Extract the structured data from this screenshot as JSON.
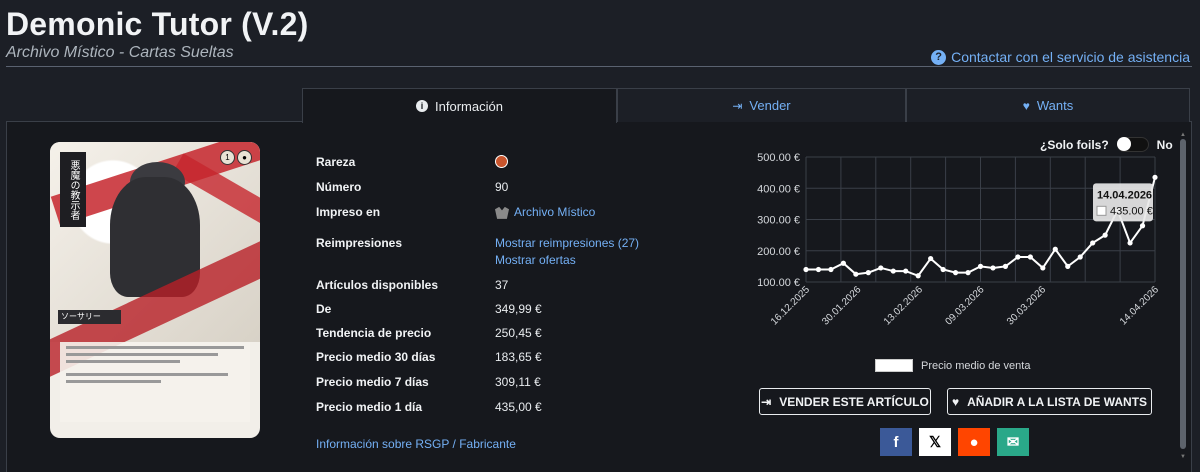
{
  "header": {
    "title": "Demonic Tutor (V.2)",
    "subtitle": "Archivo Místico - Cartas Sueltas",
    "support_link": "Contactar con el servicio de asistencia"
  },
  "tabs": [
    {
      "label": "Información",
      "icon": "info-icon",
      "active": true
    },
    {
      "label": "Vender",
      "icon": "sell-icon",
      "active": false
    },
    {
      "label": "Wants",
      "icon": "heart-icon",
      "active": false
    }
  ],
  "details": {
    "rareza_label": "Rareza",
    "rareza_color": "#c9552d",
    "numero_label": "Número",
    "numero_value": "90",
    "impreso_label": "Impreso en",
    "impreso_value": "Archivo Místico",
    "reimpresiones_label": "Reimpresiones",
    "reimpresiones_link": "Mostrar reimpresiones (27)",
    "ofertas_link": "Mostrar ofertas",
    "disponibles_label": "Artículos disponibles",
    "disponibles_value": "37",
    "de_label": "De",
    "de_value": "349,99 €",
    "tendencia_label": "Tendencia de precio",
    "tendencia_value": "250,45 €",
    "p30_label": "Precio medio 30 días",
    "p30_value": "183,65 €",
    "p7_label": "Precio medio 7 días",
    "p7_value": "309,11 €",
    "p1_label": "Precio medio 1 día",
    "p1_value": "435,00 €",
    "rsgp_link": "Información sobre RSGP",
    "fabricante_link": "Fabricante"
  },
  "card": {
    "name_vertical": "悪魔の教示者",
    "type_line": "ソーサリー",
    "cost": [
      "1",
      "●"
    ]
  },
  "foils": {
    "label": "¿Solo foils?",
    "value": "No"
  },
  "chart_data": {
    "type": "line",
    "ylabel": "",
    "ylim": [
      100,
      500
    ],
    "yticks": [
      "500.00 €",
      "400.00 €",
      "300.00 €",
      "200.00 €",
      "100.00 €"
    ],
    "xticks": [
      "16.12.2025",
      "30.01.2026",
      "13.02.2026",
      "09.03.2026",
      "30.03.2026",
      "14.04.2026"
    ],
    "xtick_index": [
      0,
      5,
      11,
      17,
      23,
      34
    ],
    "series": [
      {
        "name": "Precio medio de venta",
        "values": [
          140,
          140,
          140,
          160,
          125,
          130,
          145,
          135,
          135,
          120,
          175,
          140,
          130,
          130,
          150,
          145,
          150,
          180,
          180,
          145,
          205,
          150,
          180,
          225,
          250,
          330,
          225,
          280,
          435
        ],
        "color": "#ffffff"
      }
    ],
    "tooltip": {
      "date": "14.04.2026",
      "value": "435.00 €"
    },
    "grid": true,
    "legend": "bottom"
  },
  "actions": {
    "sell_label": "VENDER ESTE ARTÍCULO",
    "wants_label": "AÑADIR A LA LISTA DE WANTS"
  },
  "share": [
    {
      "name": "facebook",
      "glyph": "f",
      "color": "#3b5998"
    },
    {
      "name": "x",
      "glyph": "𝕏",
      "color": "#ffffff"
    },
    {
      "name": "reddit",
      "glyph": "●",
      "color": "#ff4500"
    },
    {
      "name": "email",
      "glyph": "✉",
      "color": "#2aa889"
    }
  ]
}
